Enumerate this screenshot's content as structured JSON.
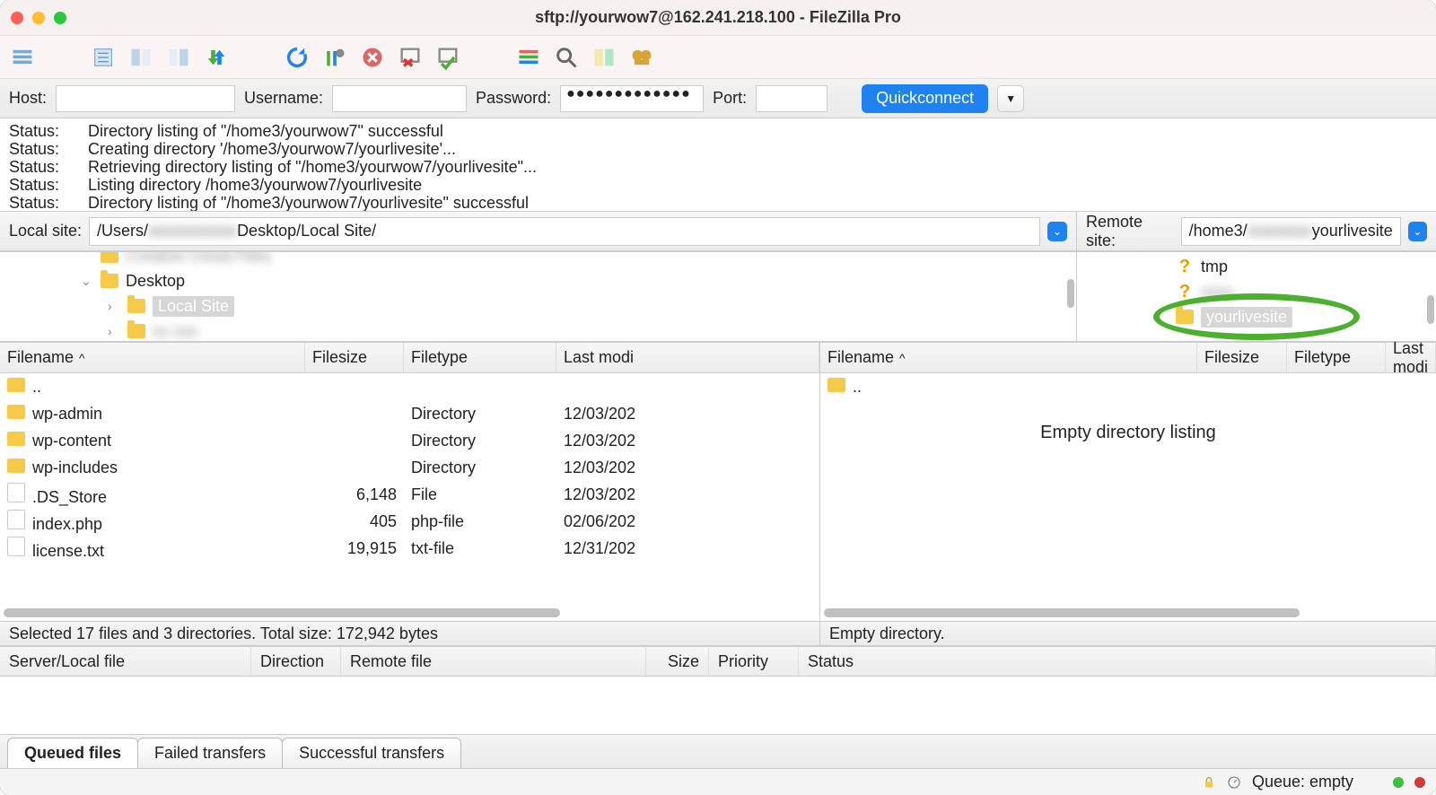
{
  "window": {
    "title": "sftp://yourwow7@162.241.218.100 - FileZilla Pro"
  },
  "quickconnect": {
    "host_label": "Host:",
    "host_value": "",
    "user_label": "Username:",
    "user_value": "",
    "pass_label": "Password:",
    "pass_value": "●●●●●●●●●●●●●",
    "port_label": "Port:",
    "port_value": "",
    "button": "Quickconnect"
  },
  "log": [
    {
      "label": "Status:",
      "msg": "Directory listing of \"/home3/yourwow7\" successful"
    },
    {
      "label": "Status:",
      "msg": "Creating directory '/home3/yourwow7/yourlivesite'..."
    },
    {
      "label": "Status:",
      "msg": "Retrieving directory listing of \"/home3/yourwow7/yourlivesite\"..."
    },
    {
      "label": "Status:",
      "msg": "Listing directory /home3/yourwow7/yourlivesite"
    },
    {
      "label": "Status:",
      "msg": "Directory listing of \"/home3/yourwow7/yourlivesite\" successful"
    }
  ],
  "local": {
    "label": "Local site:",
    "path_prefix": "/Users/",
    "path_mid_blurred": "xxxxxxxxxxx",
    "path_suffix": "Desktop/Local Site/",
    "tree": {
      "row0_blurred": "Creative Cloud Files",
      "row1": "Desktop",
      "row2_selected": "Local Site",
      "row3_blurred": "xx xxx"
    },
    "columns": {
      "filename": "Filename",
      "filesize": "Filesize",
      "filetype": "Filetype",
      "lastmod": "Last modi"
    },
    "files": [
      {
        "icon": "folder",
        "name": "..",
        "size": "",
        "type": "",
        "mod": ""
      },
      {
        "icon": "folder",
        "name": "wp-admin",
        "size": "",
        "type": "Directory",
        "mod": "12/03/202"
      },
      {
        "icon": "folder",
        "name": "wp-content",
        "size": "",
        "type": "Directory",
        "mod": "12/03/202"
      },
      {
        "icon": "folder",
        "name": "wp-includes",
        "size": "",
        "type": "Directory",
        "mod": "12/03/202"
      },
      {
        "icon": "file",
        "name": ".DS_Store",
        "size": "6,148",
        "type": "File",
        "mod": "12/03/202"
      },
      {
        "icon": "file",
        "name": "index.php",
        "size": "405",
        "type": "php-file",
        "mod": "02/06/202"
      },
      {
        "icon": "file",
        "name": "license.txt",
        "size": "19,915",
        "type": "txt-file",
        "mod": "12/31/202"
      }
    ],
    "status": "Selected 17 files and 3 directories. Total size: 172,942 bytes"
  },
  "remote": {
    "label": "Remote site:",
    "path_prefix": "/home3/",
    "path_mid_blurred": "xxxxxxxx",
    "path_suffix": "yourlivesite",
    "tree": {
      "row0": "tmp",
      "row1_blurred": "xxxx",
      "row2_selected": "yourlivesite"
    },
    "columns": {
      "filename": "Filename",
      "filesize": "Filesize",
      "filetype": "Filetype",
      "lastmod": "Last modi"
    },
    "files": [
      {
        "icon": "folder",
        "name": "..",
        "size": "",
        "type": "",
        "mod": ""
      }
    ],
    "empty_msg": "Empty directory listing",
    "status": "Empty directory."
  },
  "transfer": {
    "columns": {
      "serverlocal": "Server/Local file",
      "direction": "Direction",
      "remotefile": "Remote file",
      "size": "Size",
      "priority": "Priority",
      "status": "Status"
    }
  },
  "tabs": {
    "queued": "Queued files",
    "failed": "Failed transfers",
    "successful": "Successful transfers"
  },
  "statusbar": {
    "queue": "Queue: empty"
  }
}
